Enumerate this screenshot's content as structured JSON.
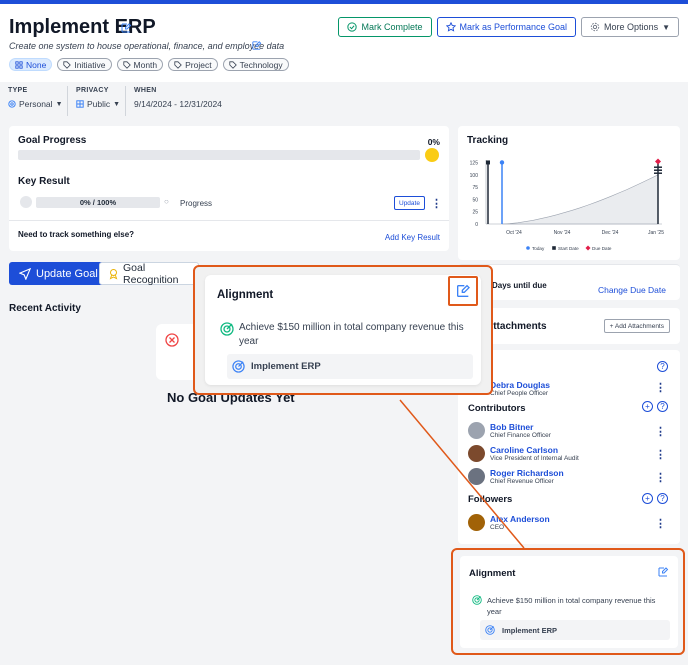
{
  "header": {
    "title": "Implement ERP",
    "subtitle": "Create one system to house operational, finance, and employee data",
    "chips": [
      "None",
      "Initiative",
      "Month",
      "Project",
      "Technology"
    ],
    "buttons": {
      "mark_complete": "Mark Complete",
      "mark_performance": "Mark as Performance Goal",
      "more_options": "More Options"
    }
  },
  "meta": {
    "type_label": "TYPE",
    "type_value": "Personal",
    "privacy_label": "PRIVACY",
    "privacy_value": "Public",
    "when_label": "WHEN",
    "when_value": "9/14/2024 - 12/31/2024"
  },
  "goal_progress": {
    "title": "Goal Progress",
    "percent": "0%",
    "progress_fraction": 0,
    "key_result_title": "Key Result",
    "kr_value": "0% / 100%",
    "kr_label": "Progress",
    "update_btn": "Update",
    "track_prompt": "Need to track something else?",
    "add_key_result": "Add Key Result"
  },
  "actions": {
    "update_goal": "Update Goal",
    "goal_recognition": "Goal Recognition"
  },
  "recent_activity": {
    "title": "Recent Activity",
    "empty_text": "No Goal Updates Yet"
  },
  "tracking": {
    "title": "Tracking",
    "days_until_due": "Days until due",
    "change_due_date": "Change Due Date"
  },
  "chart_data": {
    "type": "line",
    "title": "Tracking",
    "yticks": [
      0,
      25,
      50,
      75,
      100,
      125
    ],
    "ylim": [
      0,
      130
    ],
    "xticks": [
      "Oct '24",
      "Nov '24",
      "Dec '24",
      "Jan '25"
    ],
    "legend": [
      "Today",
      "Start Date",
      "Due Date"
    ],
    "legend_position": "bottom",
    "colors": {
      "today": "#3b82f6",
      "start": "#1f2937",
      "due": "#e11d48",
      "area": "#d1d5db"
    }
  },
  "attachments": {
    "title": "Attachments",
    "add_btn": "+ Add Attachments"
  },
  "people": {
    "owner": {
      "name": "Debra Douglas",
      "role": "Chief People Officer"
    },
    "contributors_title": "Contributors",
    "contributors": [
      {
        "name": "Bob Bitner",
        "role": "Chief Finance Officer"
      },
      {
        "name": "Caroline Carlson",
        "role": "Vice President of Internal Audit"
      },
      {
        "name": "Roger Richardson",
        "role": "Chief Revenue Officer"
      }
    ],
    "followers_title": "Followers",
    "followers": [
      {
        "name": "Alex Anderson",
        "role": "CEO"
      }
    ]
  },
  "alignment": {
    "title": "Alignment",
    "parent_goal": "Achieve $150 million in total company revenue this year",
    "current_goal": "Implement ERP"
  }
}
